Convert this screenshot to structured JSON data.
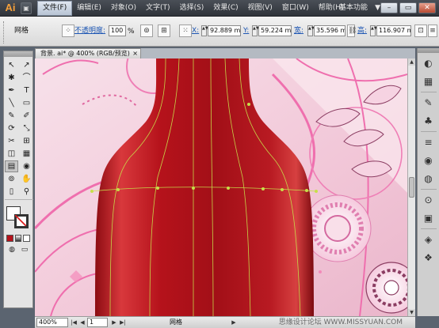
{
  "app": {
    "logo": "Ai"
  },
  "menubar": {
    "items": [
      "文件(F)",
      "编辑(E)",
      "对象(O)",
      "文字(T)",
      "选择(S)",
      "效果(C)",
      "视图(V)",
      "窗口(W)",
      "帮助(H)"
    ],
    "workspace": "基本功能",
    "workspace_caret": "▼"
  },
  "controlbar": {
    "mode_label": "网格",
    "opacity_label": "不透明度:",
    "opacity_value": "100",
    "percent": "%",
    "x_label": "X:",
    "x_value": "92.889 mm",
    "y_label": "Y:",
    "y_value": "59.224 mm",
    "width_label": "宽:",
    "width_value": "35.596 mm",
    "height_label": "高:",
    "height_value": "116.907 mm"
  },
  "document": {
    "tab_title": "背景. ai* @ 400% (RGB/预览)",
    "tab_close": "×"
  },
  "statusbar": {
    "zoom": "400%",
    "page": "1",
    "status_text": "网格",
    "first_arrow": "|◀",
    "prev_arrow": "◀",
    "next_arrow": "▶",
    "last_arrow": "▶|",
    "menu_arrow": "▶",
    "watermark": "思缘设计论坛 WWW.MISSYUAN.COM"
  },
  "tools": [
    "↖",
    "↗",
    "✱",
    "⌒",
    "✒",
    "T",
    "╲",
    "▭",
    "✎",
    "✐",
    "⟳",
    "⤡",
    "✂",
    "⊞",
    "◫",
    "▦",
    "▤",
    "◉",
    "⊚",
    "✋",
    "▯",
    "⚲"
  ],
  "colors": {
    "accent_fill": "#b5121b",
    "canvas_pink": "#f3d1de",
    "mesh_line": "#c7e04a"
  }
}
